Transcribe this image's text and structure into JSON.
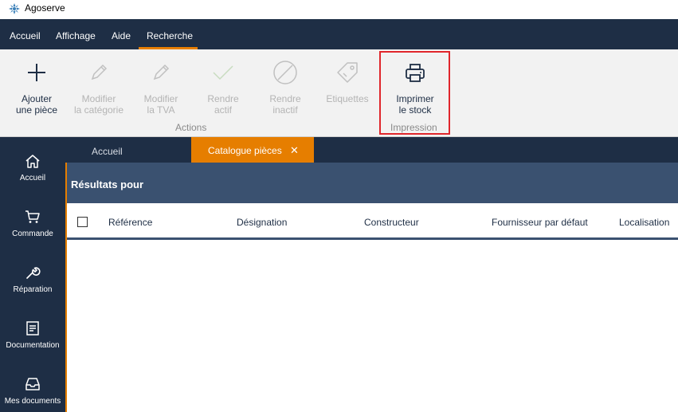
{
  "app": {
    "title": "Agoserve"
  },
  "menu": {
    "items": [
      "Accueil",
      "Affichage",
      "Aide",
      "Recherche"
    ],
    "active": "Recherche"
  },
  "ribbon": {
    "buttons": [
      {
        "line1": "Ajouter",
        "line2": "une pièce",
        "icon": "plus-icon",
        "enabled": true
      },
      {
        "line1": "Modifier",
        "line2": "la catégorie",
        "icon": "pencil-icon",
        "enabled": false
      },
      {
        "line1": "Modifier",
        "line2": "la TVA",
        "icon": "pencil-icon",
        "enabled": false
      },
      {
        "line1": "Rendre",
        "line2": "actif",
        "icon": "checkmark-icon",
        "enabled": false
      },
      {
        "line1": "Rendre",
        "line2": "inactif",
        "icon": "prohibited-icon",
        "enabled": false
      },
      {
        "line1": "Etiquettes",
        "line2": "",
        "icon": "tag-icon",
        "enabled": false
      },
      {
        "line1": "Imprimer",
        "line2": "le stock",
        "icon": "printer-icon",
        "enabled": true
      }
    ],
    "groups": {
      "actions": "Actions",
      "impression": "Impression"
    }
  },
  "sidebar": {
    "items": [
      {
        "label": "Accueil",
        "icon": "home-icon"
      },
      {
        "label": "Commande",
        "icon": "cart-icon"
      },
      {
        "label": "Réparation",
        "icon": "wrench-icon"
      },
      {
        "label": "Documentation",
        "icon": "document-icon"
      },
      {
        "label": "Mes documents",
        "icon": "inbox-icon"
      }
    ]
  },
  "tabs": {
    "home": "Accueil",
    "catalog": "Catalogue pièces",
    "close_glyph": "✕"
  },
  "results": {
    "title": "Résultats pour"
  },
  "table": {
    "columns": [
      "Référence",
      "Désignation",
      "Constructeur",
      "Fournisseur par défaut",
      "Localisation"
    ]
  },
  "colors": {
    "navy": "#1e2e45",
    "header_blue": "#3a5170",
    "accent_orange": "#e67e00",
    "highlight_red": "#e0262c"
  }
}
